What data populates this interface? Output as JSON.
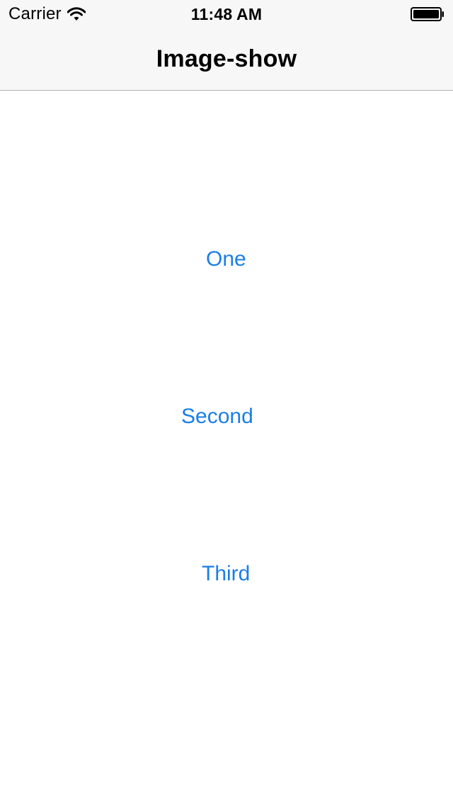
{
  "status_bar": {
    "carrier": "Carrier",
    "time": "11:48 AM",
    "wifi_icon": "wifi-icon",
    "battery_icon": "battery-icon"
  },
  "nav_bar": {
    "title": "Image-show"
  },
  "buttons": {
    "one": "One",
    "second": "Second",
    "third": "Third"
  },
  "colors": {
    "accent": "#1a7ee6",
    "nav_background": "#f7f7f7"
  }
}
